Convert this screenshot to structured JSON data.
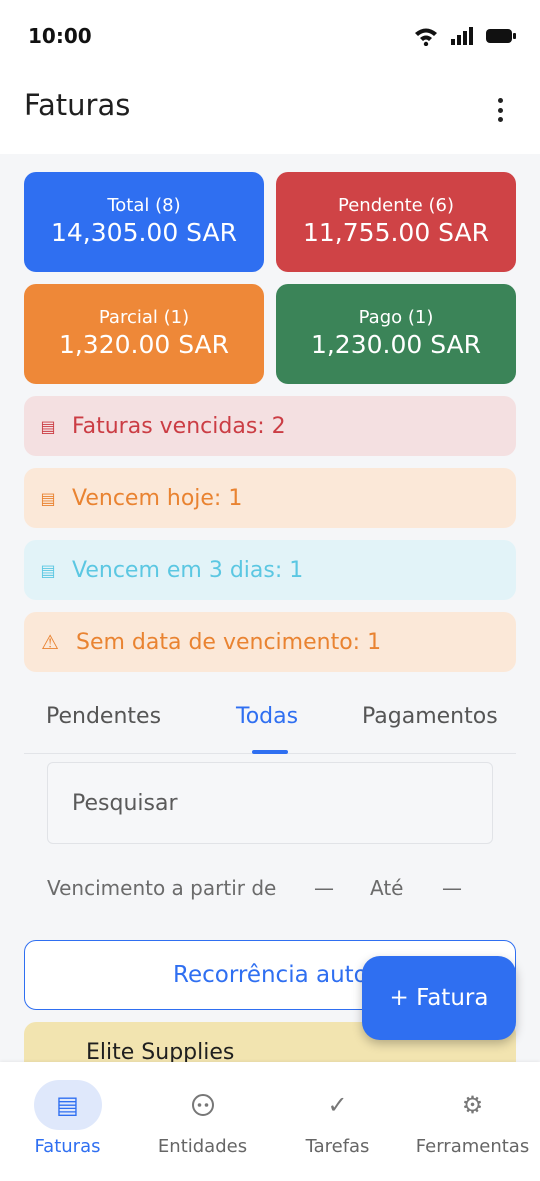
{
  "status_bar": {
    "time": "10:00"
  },
  "app_bar": {
    "title": "Faturas"
  },
  "summary_cards": {
    "total": {
      "label": "Total (8)",
      "value": "14,305.00 SAR"
    },
    "pendente": {
      "label": "Pendente (6)",
      "value": "11,755.00 SAR"
    },
    "parcial": {
      "label": "Parcial (1)",
      "value": "1,320.00 SAR"
    },
    "pago": {
      "label": "Pago (1)",
      "value": "1,230.00 SAR"
    }
  },
  "alerts": {
    "vencidas": "Faturas vencidas: 2",
    "hoje": "Vencem hoje: 1",
    "tres_dias": "Vencem em 3 dias: 1",
    "sem_data": "Sem data de vencimento: 1"
  },
  "tabs": {
    "pendentes": "Pendentes",
    "todas": "Todas",
    "pagamentos": "Pagamentos",
    "selected": "Todas"
  },
  "search": {
    "placeholder": "Pesquisar"
  },
  "filter": {
    "from_label": "Vencimento a partir de",
    "from_value": "—",
    "to_label": "Até",
    "to_value": "—"
  },
  "recurrence_button": "Recorrência auto",
  "fab": {
    "label": "+ Fatura"
  },
  "invoice_list": [
    {
      "entity": "Elite Supplies"
    }
  ],
  "bottom_nav": {
    "faturas": "Faturas",
    "entidades": "Entidades",
    "tarefas": "Tarefas",
    "ferramentas": "Ferramentas",
    "active": "Faturas"
  },
  "colors": {
    "accent": "#2f6ff1",
    "pending": "#cf4346",
    "partial": "#ee8838",
    "paid": "#3b8458"
  }
}
